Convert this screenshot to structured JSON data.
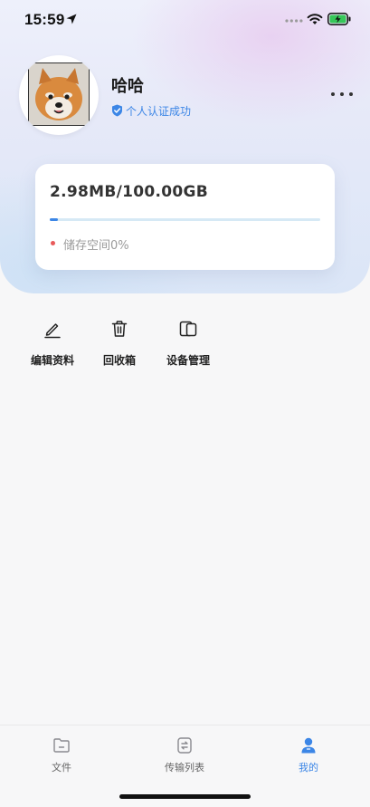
{
  "status_bar": {
    "time": "15:59",
    "icons": [
      "location-arrow-icon",
      "signal-dots-icon",
      "wifi-icon",
      "battery-charging-icon"
    ]
  },
  "profile": {
    "username": "哈哈",
    "verify_text": "个人认证成功",
    "avatar_icon": "shiba-dog-avatar"
  },
  "storage": {
    "amount": "2.98MB/100.00GB",
    "label": "储存空间0%",
    "used_fraction": 0.0298
  },
  "actions": [
    {
      "label": "编辑资料",
      "icon": "edit-pen-icon"
    },
    {
      "label": "回收箱",
      "icon": "trash-icon"
    },
    {
      "label": "设备管理",
      "icon": "devices-icon"
    }
  ],
  "tabs": [
    {
      "label": "文件",
      "icon": "folder-icon",
      "active": false
    },
    {
      "label": "传输列表",
      "icon": "transfer-icon",
      "active": false
    },
    {
      "label": "我的",
      "icon": "user-icon",
      "active": true
    }
  ],
  "colors": {
    "accent": "#3c86e6",
    "dot_red": "#e85a5a",
    "track": "#d6e9f5"
  }
}
